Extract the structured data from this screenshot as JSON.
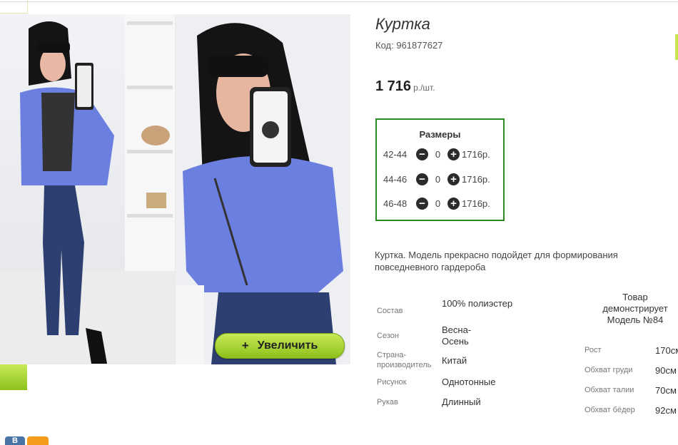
{
  "product": {
    "title": "Куртка",
    "code_label": "Код:",
    "code": "961877627",
    "price": "1 716",
    "price_unit": "р./шт."
  },
  "gallery": {
    "zoom_label": "Увеличить",
    "zoom_icon": "plus-icon"
  },
  "sizes": {
    "title": "Размеры",
    "rows": [
      {
        "size": "42-44",
        "qty": "0",
        "price": "1716р."
      },
      {
        "size": "44-46",
        "qty": "0",
        "price": "1716р."
      },
      {
        "size": "46-48",
        "qty": "0",
        "price": "1716р."
      }
    ]
  },
  "description": "Куртка. Модель прекрасно подойдет для формирования повседневного гардероба",
  "properties": [
    {
      "key": "Состав",
      "value": "100% полиэстер"
    },
    {
      "key": "Сезон",
      "value": "Весна-Осень"
    },
    {
      "key": "Страна-производитель",
      "value": "Китай"
    },
    {
      "key": "Рисунок",
      "value": "Однотонные"
    },
    {
      "key": "Рукав",
      "value": "Длинный"
    }
  ],
  "model": {
    "heading": "Товар демонстрирует Модель №84",
    "measurements": [
      {
        "key": "Рост",
        "value": "170см"
      },
      {
        "key": "Обхват груди",
        "value": "90см"
      },
      {
        "key": "Обхват талии",
        "value": "70см"
      },
      {
        "key": "Обхват бёдер",
        "value": "92см"
      }
    ]
  },
  "social": {
    "vk_label": "В"
  },
  "colors": {
    "accent_green": "#8dc01b",
    "sizes_border": "#2a8a22",
    "jacket_blue": "#6b7fe0"
  }
}
